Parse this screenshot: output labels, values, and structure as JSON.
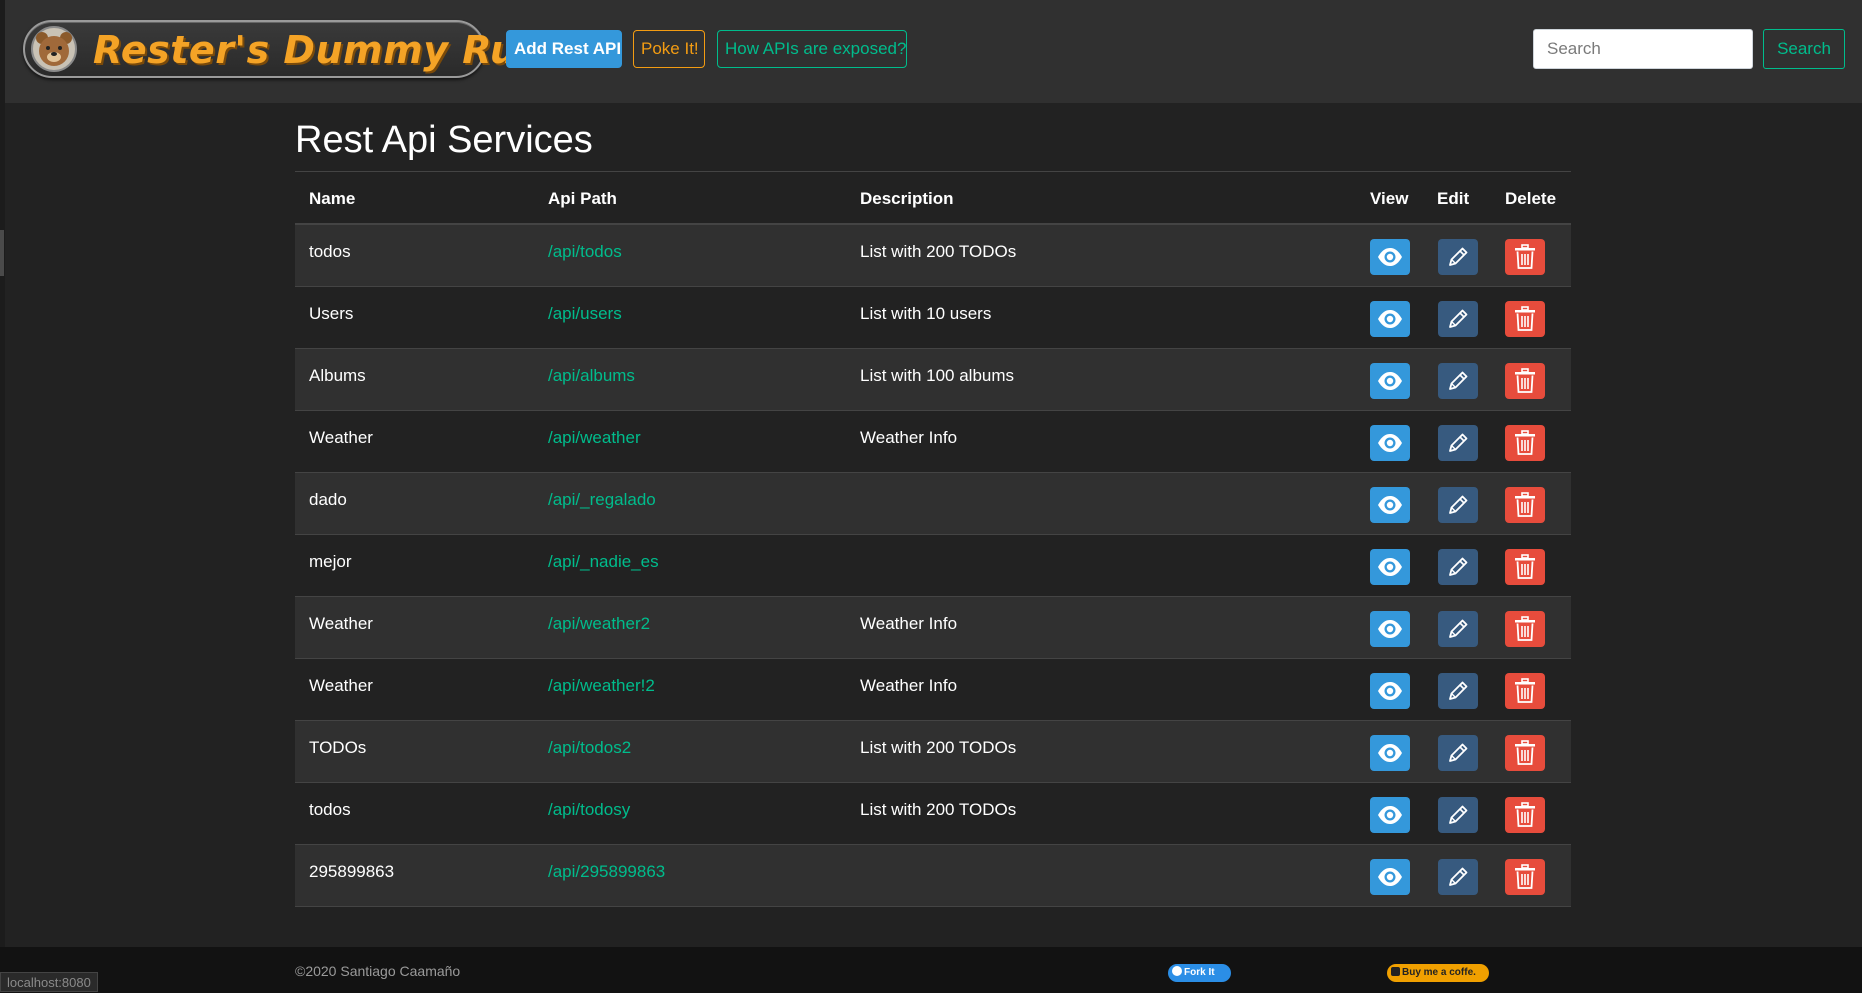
{
  "navbar": {
    "brand_title": "Rester's Dummy Run",
    "add_label": "Add Rest API",
    "poke_label": "Poke It!",
    "how_label": "How APIs are exposed?",
    "search_placeholder": "Search",
    "search_button": "Search"
  },
  "main": {
    "title": "Rest Api Services",
    "columns": [
      "Name",
      "Api Path",
      "Description",
      "View",
      "Edit",
      "Delete"
    ],
    "rows": [
      {
        "name": "todos",
        "path": "/api/todos",
        "description": "List with 200 TODOs"
      },
      {
        "name": "Users",
        "path": "/api/users",
        "description": "List with 10 users"
      },
      {
        "name": "Albums",
        "path": "/api/albums",
        "description": "List with 100 albums"
      },
      {
        "name": "Weather",
        "path": "/api/weather",
        "description": "Weather Info"
      },
      {
        "name": "dado",
        "path": "/api/_regalado",
        "description": ""
      },
      {
        "name": "mejor",
        "path": "/api/_nadie_es",
        "description": ""
      },
      {
        "name": "Weather",
        "path": "/api/weather2",
        "description": "Weather Info"
      },
      {
        "name": "Weather",
        "path": "/api/weather!2",
        "description": "Weather Info"
      },
      {
        "name": "TODOs",
        "path": "/api/todos2",
        "description": "List with 200 TODOs"
      },
      {
        "name": "todos",
        "path": "/api/todosy",
        "description": "List with 200 TODOs"
      },
      {
        "name": "295899863",
        "path": "/api/295899863",
        "description": ""
      }
    ],
    "icons": {
      "view": "eye-icon",
      "edit": "pencil-icon",
      "delete": "trash-icon"
    }
  },
  "footer": {
    "copyright": "©2020 Santiago Caamaño",
    "fork_label": "Fork It",
    "coffee_label": "Buy me a coffe."
  },
  "status_bar": "localhost:8080",
  "colors": {
    "background": "#222222",
    "navbar": "#303030",
    "primary": "#3498db",
    "warning": "#f39c12",
    "success": "#00bc8c",
    "edit": "#375a7f",
    "danger": "#e74c3c"
  }
}
